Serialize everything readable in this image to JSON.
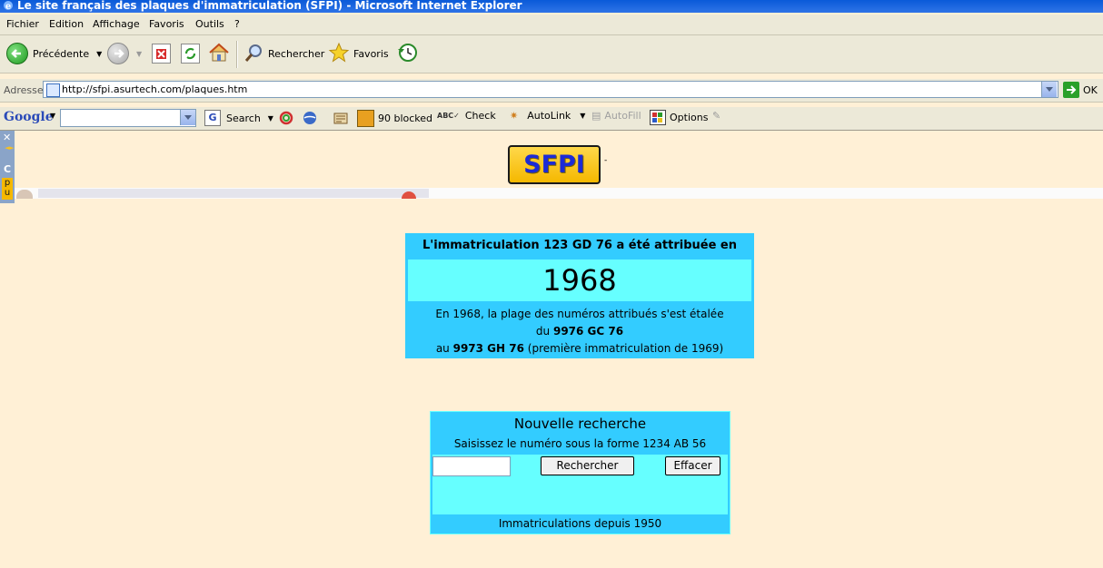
{
  "window": {
    "title": "Le site français des plaques d'immatriculation (SFPI) - Microsoft Internet Explorer"
  },
  "menu": [
    "Fichier",
    "Edition",
    "Affichage",
    "Favoris",
    "Outils",
    "?"
  ],
  "toolbar": {
    "back_label": "Précédente",
    "search_label": "Rechercher",
    "favorites_label": "Favoris"
  },
  "address": {
    "label": "Adresse",
    "url": "http://sfpi.asurtech.com/plaques.htm",
    "go_label": "OK"
  },
  "google_bar": {
    "brand": "Google",
    "search_label": "Search",
    "blocked_label": "90 blocked",
    "check_label": "Check",
    "autolink_label": "AutoLink",
    "autofill_label": "AutoFill",
    "options_label": "Options"
  },
  "side_panel": {
    "letters": [
      "C",
      "p",
      "u"
    ]
  },
  "page": {
    "logo": "SFPI",
    "result": {
      "heading": "L'immatriculation 123 GD 76 a été attribuée en",
      "year": "1968",
      "line1": "En 1968, la plage des numéros attribués s'est étalée",
      "line2_prefix": "du",
      "line2_plate": "9976 GC 76",
      "line3_prefix": "au",
      "line3_plate": "9973 GH 76",
      "line3_suffix": "(première immatriculation de 1969)"
    },
    "search": {
      "title": "Nouvelle recherche",
      "hint": "Saisissez le numéro sous la forme 1234 AB 56",
      "input_value": "",
      "search_button": "Rechercher",
      "clear_button": "Effacer",
      "footer": "Immatriculations depuis 1950"
    }
  },
  "colors": {
    "page_bg": "#fff0d6",
    "panel": "#33ccff",
    "panel_light": "#66ffff",
    "logo_bg": "#f5b800",
    "logo_text": "#1c2bd6"
  }
}
